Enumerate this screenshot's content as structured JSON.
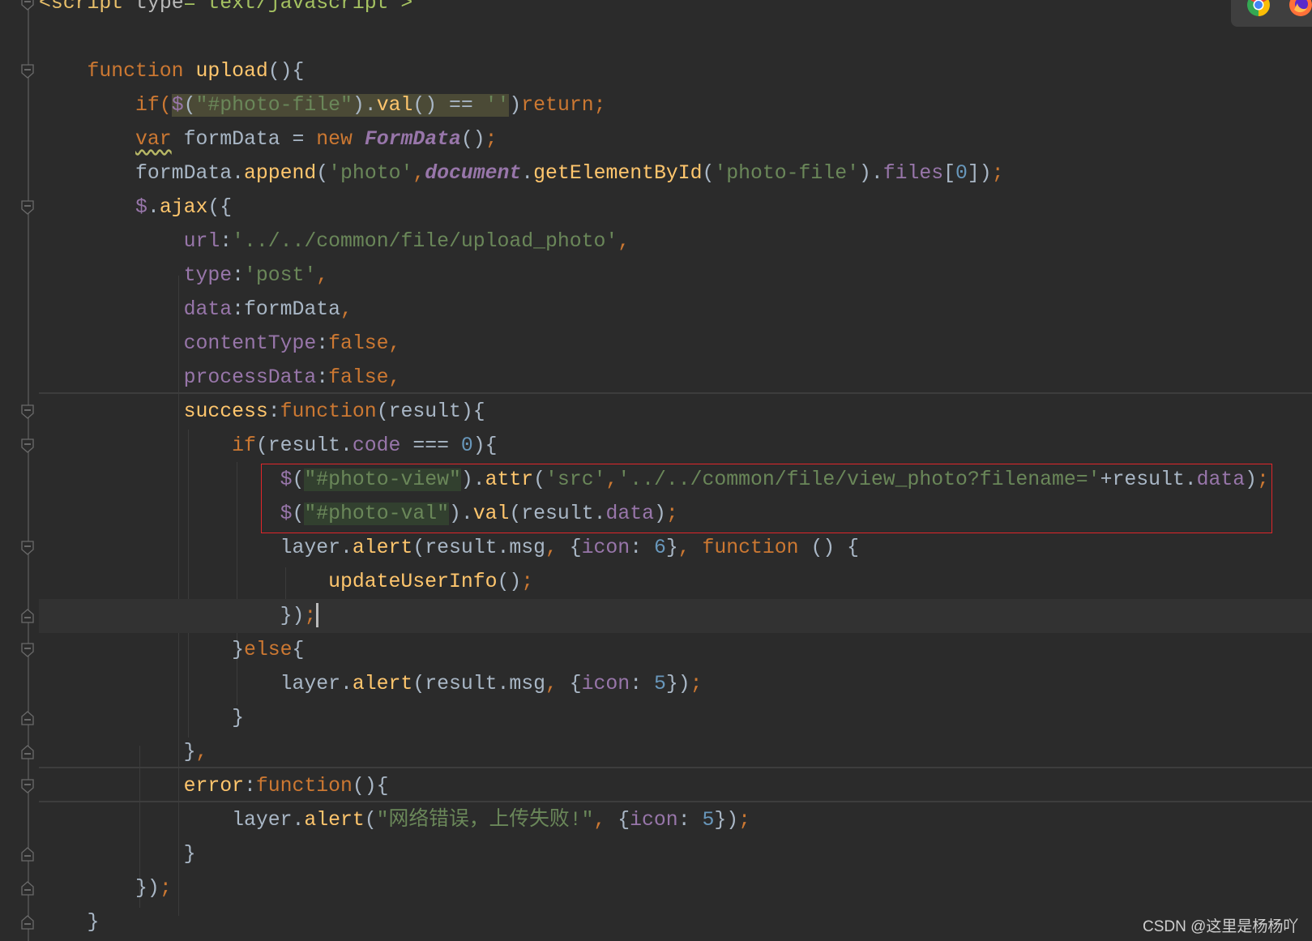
{
  "editor": {
    "theme_colors": {
      "background": "#2b2b2b",
      "keyword": "#cc7832",
      "function": "#ffc66d",
      "text": "#a9b7c6",
      "string": "#6a8759",
      "property": "#9876aa",
      "number": "#6897bb",
      "annotation_box": "#e0262a"
    },
    "current_line": 18,
    "annotated_lines": [
      14,
      15
    ],
    "lines": [
      [
        [
          "<script",
          "tag"
        ],
        [
          " type",
          "attr"
        ],
        [
          "= text/javascript >",
          "av"
        ]
      ],
      [],
      [
        [
          "    function ",
          "k"
        ],
        [
          "upload",
          "f"
        ],
        [
          "(){",
          "t"
        ]
      ],
      [
        [
          "        if(",
          "k"
        ],
        [
          "$",
          "p",
          "hl"
        ],
        [
          "(",
          "t",
          "hl"
        ],
        [
          "\"#photo-file\"",
          "s",
          "hl"
        ],
        [
          ").",
          "t",
          "hl"
        ],
        [
          "val",
          "f",
          "hl"
        ],
        [
          "() == ",
          "t",
          "hl"
        ],
        [
          "''",
          "s",
          "hl"
        ],
        [
          ")",
          "t"
        ],
        [
          "return;",
          "k"
        ]
      ],
      [
        [
          "        ",
          "t"
        ],
        [
          "var",
          "k",
          "squig"
        ],
        [
          " formData = ",
          "t"
        ],
        [
          "new ",
          "k"
        ],
        [
          "FormData",
          "pi"
        ],
        [
          "()",
          "t"
        ],
        [
          ";",
          "k"
        ]
      ],
      [
        [
          "        formData.",
          "t"
        ],
        [
          "append",
          "f"
        ],
        [
          "(",
          "t"
        ],
        [
          "'photo'",
          "s"
        ],
        [
          ",",
          "k"
        ],
        [
          "document",
          "pi"
        ],
        [
          ".",
          "t"
        ],
        [
          "getElementById",
          "f"
        ],
        [
          "(",
          "t"
        ],
        [
          "'photo-file'",
          "s"
        ],
        [
          ").",
          "t"
        ],
        [
          "files",
          "p"
        ],
        [
          "[",
          "t"
        ],
        [
          "0",
          "n"
        ],
        [
          "])",
          "t"
        ],
        [
          ";",
          "k"
        ]
      ],
      [
        [
          "        ",
          "t"
        ],
        [
          "$",
          "p"
        ],
        [
          ".",
          "t"
        ],
        [
          "ajax",
          "f"
        ],
        [
          "({",
          "t"
        ]
      ],
      [
        [
          "            ",
          "t"
        ],
        [
          "url",
          "p"
        ],
        [
          ":",
          "t"
        ],
        [
          "'../../common/file/upload_photo'",
          "s"
        ],
        [
          ",",
          "k"
        ]
      ],
      [
        [
          "            ",
          "t"
        ],
        [
          "type",
          "p"
        ],
        [
          ":",
          "t"
        ],
        [
          "'post'",
          "s"
        ],
        [
          ",",
          "k"
        ]
      ],
      [
        [
          "            ",
          "t"
        ],
        [
          "data",
          "p"
        ],
        [
          ":formData",
          "t"
        ],
        [
          ",",
          "k"
        ]
      ],
      [
        [
          "            ",
          "t"
        ],
        [
          "contentType",
          "p"
        ],
        [
          ":",
          "t"
        ],
        [
          "false,",
          "k"
        ]
      ],
      [
        [
          "            ",
          "t"
        ],
        [
          "processData",
          "p"
        ],
        [
          ":",
          "t"
        ],
        [
          "false,",
          "k"
        ]
      ],
      [
        [
          "            ",
          "t"
        ],
        [
          "success",
          "f"
        ],
        [
          ":",
          "t"
        ],
        [
          "function",
          "k"
        ],
        [
          "(result){",
          "t"
        ]
      ],
      [
        [
          "                if",
          "k"
        ],
        [
          "(result.",
          "t"
        ],
        [
          "code",
          "p"
        ],
        [
          " === ",
          "t"
        ],
        [
          "0",
          "n"
        ],
        [
          "){",
          "t"
        ]
      ],
      [
        [
          "                    ",
          "t"
        ],
        [
          "$",
          "p"
        ],
        [
          "(",
          "t"
        ],
        [
          "\"#photo-view\"",
          "s",
          "hl2"
        ],
        [
          ").",
          "t"
        ],
        [
          "attr",
          "f"
        ],
        [
          "(",
          "t"
        ],
        [
          "'src'",
          "s"
        ],
        [
          ",",
          "k"
        ],
        [
          "'../../common/file/view_photo?filename='",
          "s"
        ],
        [
          "+result.",
          "t"
        ],
        [
          "data",
          "p"
        ],
        [
          ")",
          "t"
        ],
        [
          ";",
          "k"
        ]
      ],
      [
        [
          "                    ",
          "t"
        ],
        [
          "$",
          "p"
        ],
        [
          "(",
          "t"
        ],
        [
          "\"#photo-val\"",
          "s",
          "hl2"
        ],
        [
          ").",
          "t"
        ],
        [
          "val",
          "f"
        ],
        [
          "(result.",
          "t"
        ],
        [
          "data",
          "p"
        ],
        [
          ")",
          "t"
        ],
        [
          ";",
          "k"
        ]
      ],
      [
        [
          "                    layer.",
          "t"
        ],
        [
          "alert",
          "f"
        ],
        [
          "(result.msg",
          "t"
        ],
        [
          ", ",
          "k"
        ],
        [
          "{",
          "t"
        ],
        [
          "icon",
          "p"
        ],
        [
          ": ",
          "t"
        ],
        [
          "6",
          "n"
        ],
        [
          "}",
          "t"
        ],
        [
          ", ",
          "k"
        ],
        [
          "function ",
          "k"
        ],
        [
          "() {",
          "t"
        ]
      ],
      [
        [
          "                        ",
          "t"
        ],
        [
          "updateUserInfo",
          "f"
        ],
        [
          "()",
          "t"
        ],
        [
          ";",
          "k"
        ]
      ],
      [
        [
          "                    })",
          "t"
        ],
        [
          ";",
          "k"
        ]
      ],
      [
        [
          "                }",
          "t"
        ],
        [
          "else",
          "k"
        ],
        [
          "{",
          "t"
        ]
      ],
      [
        [
          "                    layer.",
          "t"
        ],
        [
          "alert",
          "f"
        ],
        [
          "(result.msg",
          "t"
        ],
        [
          ", ",
          "k"
        ],
        [
          "{",
          "t"
        ],
        [
          "icon",
          "p"
        ],
        [
          ": ",
          "t"
        ],
        [
          "5",
          "n"
        ],
        [
          "})",
          "t"
        ],
        [
          ";",
          "k"
        ]
      ],
      [
        [
          "                }",
          "t"
        ]
      ],
      [
        [
          "            }",
          "t"
        ],
        [
          ",",
          "k"
        ]
      ],
      [
        [
          "            ",
          "t"
        ],
        [
          "error",
          "f"
        ],
        [
          ":",
          "t"
        ],
        [
          "function",
          "k"
        ],
        [
          "(){",
          "t"
        ]
      ],
      [
        [
          "                layer.",
          "t"
        ],
        [
          "alert",
          "f"
        ],
        [
          "(",
          "t"
        ],
        [
          "\"网络错误，上传失败!\"",
          "s"
        ],
        [
          ", ",
          "k"
        ],
        [
          "{",
          "t"
        ],
        [
          "icon",
          "p"
        ],
        [
          ": ",
          "t"
        ],
        [
          "5",
          "n"
        ],
        [
          "})",
          "t"
        ],
        [
          ";",
          "k"
        ]
      ],
      [
        [
          "            }",
          "t"
        ]
      ],
      [
        [
          "        })",
          "t"
        ],
        [
          ";",
          "k"
        ]
      ],
      [
        [
          "    }",
          "t"
        ]
      ]
    ]
  },
  "dock": {
    "icons": [
      "chrome-icon",
      "firefox-icon"
    ]
  },
  "watermark": "CSDN @这里是杨杨吖"
}
